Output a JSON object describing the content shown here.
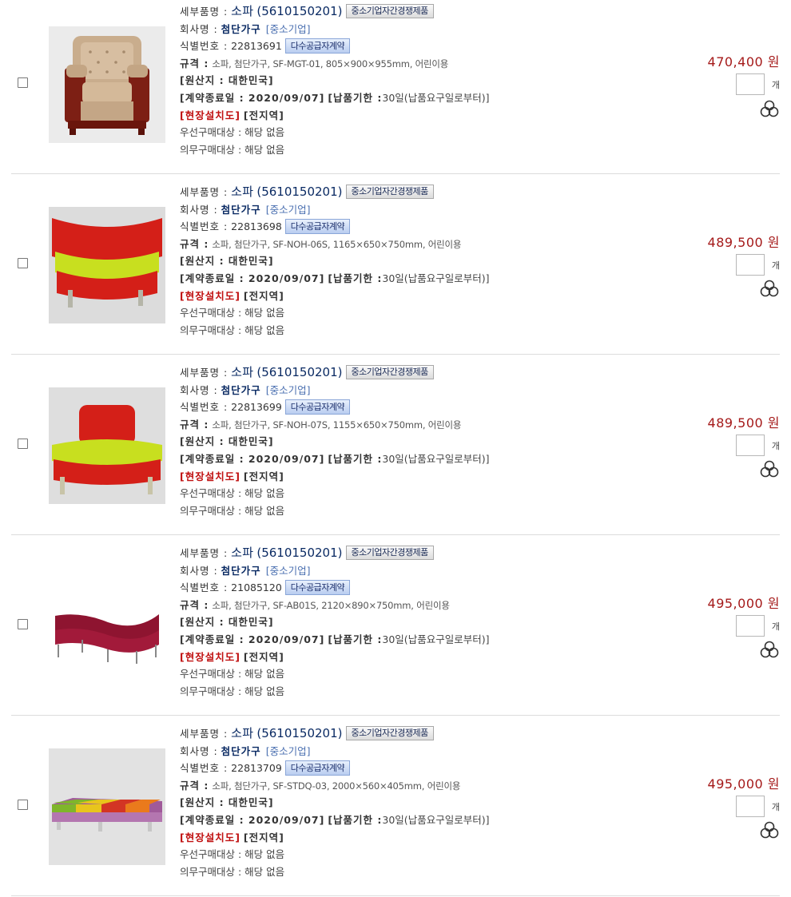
{
  "labels": {
    "detail_name": "세부품명 :",
    "company": "회사명 :",
    "id_number": "식별번호 :",
    "spec": "규격 :",
    "origin": "[원산지 : 대한민국]",
    "contract_end": "[계약종료일 : 2020/09/07]",
    "delivery": "[납품기한 :",
    "delivery_value": "30일(납품요구일로부터)]",
    "install": "[현장설치도]",
    "install_value": "[전지역]",
    "priority": "우선구매대상 : 해당 없음",
    "mandatory": "의무구매대상 : 해당 없음",
    "sme_badge": "중소기업자간경쟁제품",
    "multi_badge": "다수공급자계약",
    "unit": "개"
  },
  "products": [
    {
      "name": "소파",
      "code": "(5610150201)",
      "company": "첨단가구",
      "company_type": "[중소기업]",
      "id": "22813691",
      "spec": "소파, 첨단가구, SF-MGT-01, 805×900×955mm, 어린이용",
      "price": "470,400 원",
      "image_icon": "beige-leather-armchair",
      "qty": ""
    },
    {
      "name": "소파",
      "code": "(5610150201)",
      "company": "첨단가구",
      "company_type": "[중소기업]",
      "id": "22813698",
      "spec": "소파, 첨단가구, SF-NOH-06S, 1165×650×750mm, 어린이용",
      "price": "489,500 원",
      "image_icon": "red-lime-curved-sofa",
      "qty": ""
    },
    {
      "name": "소파",
      "code": "(5610150201)",
      "company": "첨단가구",
      "company_type": "[중소기업]",
      "id": "22813699",
      "spec": "소파, 첨단가구, SF-NOH-07S, 1155×650×750mm, 어린이용",
      "price": "489,500 원",
      "image_icon": "red-lime-backrest-sofa",
      "qty": ""
    },
    {
      "name": "소파",
      "code": "(5610150201)",
      "company": "첨단가구",
      "company_type": "[중소기업]",
      "id": "21085120",
      "spec": "소파, 첨단가구, SF-AB01S, 2120×890×750mm, 어린이용",
      "price": "495,000 원",
      "image_icon": "burgundy-curved-sofa",
      "qty": ""
    },
    {
      "name": "소파",
      "code": "(5610150201)",
      "company": "첨단가구",
      "company_type": "[중소기업]",
      "id": "22813709",
      "spec": "소파, 첨단가구, SF-STDQ-03, 2000×560×405mm, 어린이용",
      "price": "495,000 원",
      "image_icon": "multicolor-bench",
      "qty": ""
    }
  ],
  "colors": {
    "price": "#a51a1a",
    "title": "#0a2a63",
    "install_red": "#c01010"
  }
}
